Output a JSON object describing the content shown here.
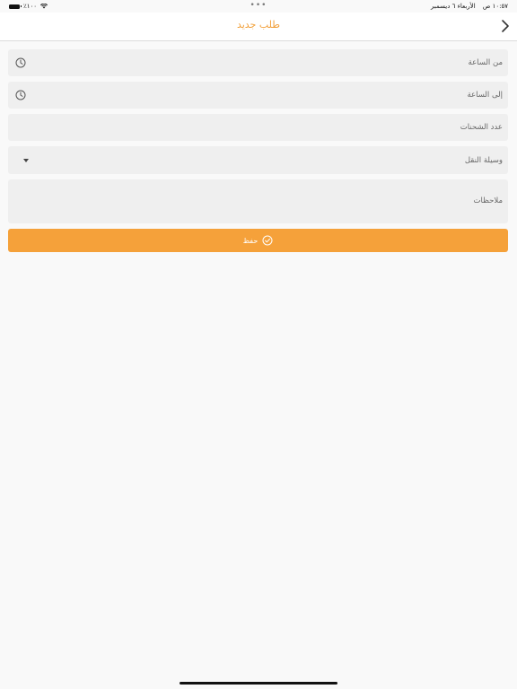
{
  "status_bar": {
    "time": "١٠:٥٧ ص",
    "date": "الأربعاء ٦ ديسمبر",
    "battery": "٪١٠٠",
    "dots": "•••"
  },
  "header": {
    "title": "طلب جديد",
    "back_icon": "chevron-right-icon"
  },
  "form": {
    "from_time": {
      "label": "من الساعة",
      "icon": "clock-icon"
    },
    "to_time": {
      "label": "إلى الساعة",
      "icon": "clock-icon"
    },
    "shipments_count": {
      "label": "عدد الشحنات"
    },
    "transport": {
      "label": "وسيلة النقل",
      "icon": "caret-down-icon"
    },
    "notes": {
      "label": "ملاحظات"
    }
  },
  "save_button": {
    "label": "حفظ",
    "icon": "check-circle-icon",
    "color": "#f5a13a"
  },
  "colors": {
    "accent": "#f2a03a",
    "field_bg": "#efefef",
    "page_bg": "#f9f9f9"
  }
}
